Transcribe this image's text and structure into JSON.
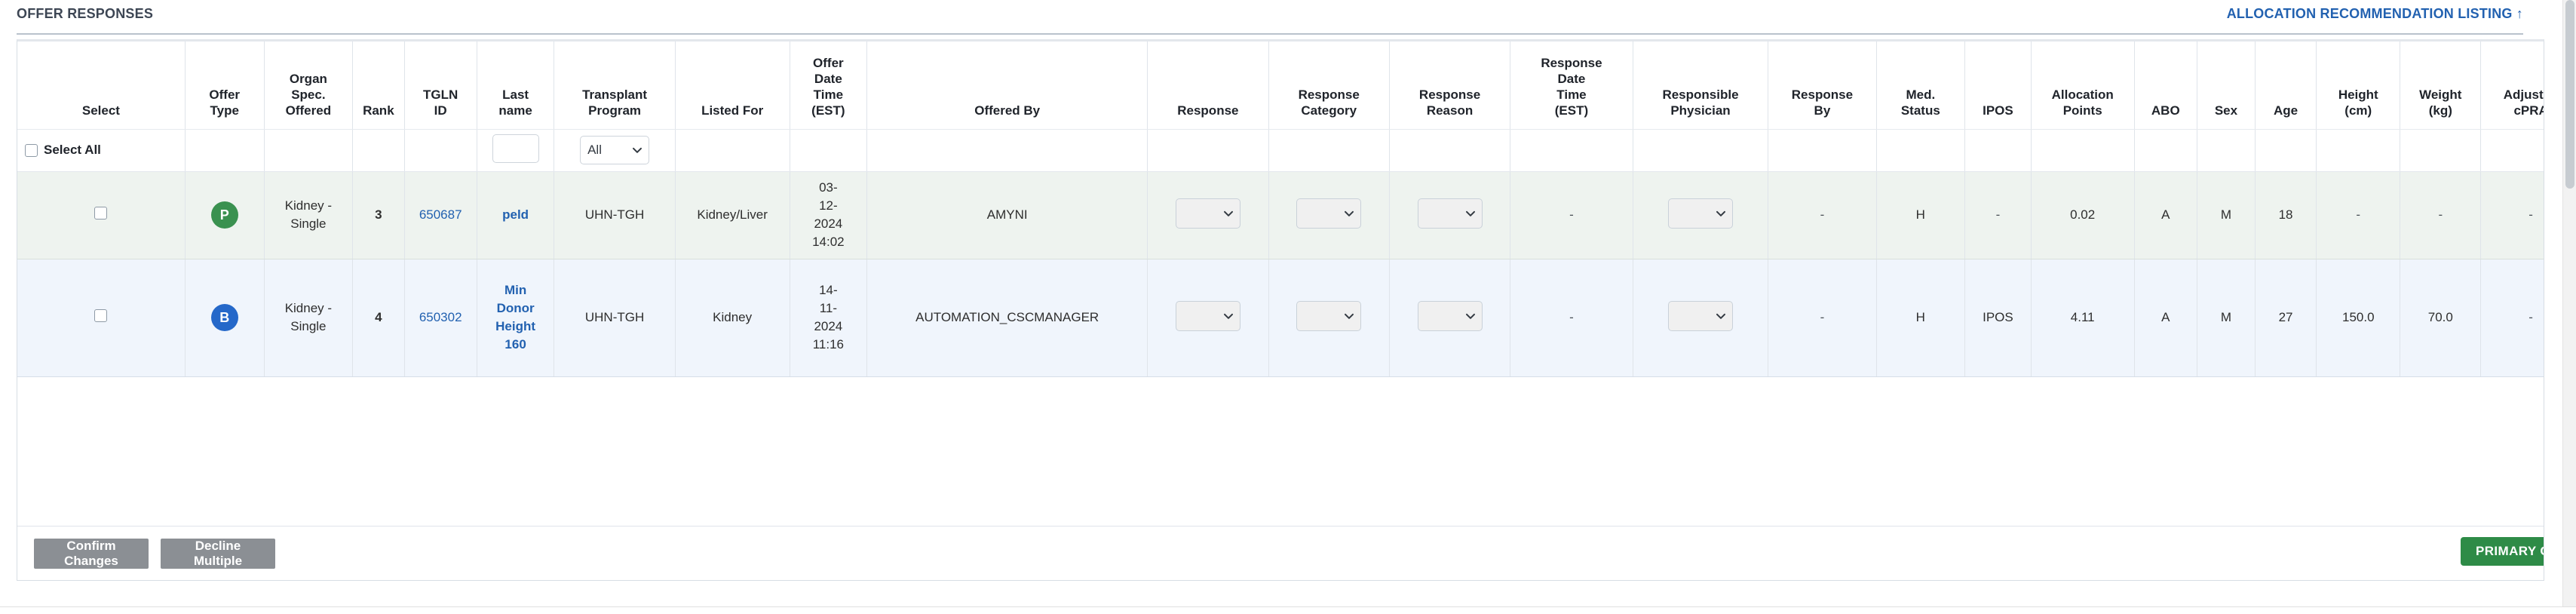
{
  "panel": {
    "title": "OFFER RESPONSES",
    "allocation_link": "ALLOCATION RECOMMENDATION LISTING",
    "allocation_link_arrow": "↑"
  },
  "table": {
    "headers": [
      "Select",
      "Offer Type",
      "Organ Spec. Offered",
      "Rank",
      "TGLN ID",
      "Last name",
      "Transplant Program",
      "Listed For",
      "Offer Date Time (EST)",
      "Offered By",
      "Response",
      "Response Category",
      "Response Reason",
      "Response Date Time (EST)",
      "Responsible Physician",
      "Response By",
      "Med. Status",
      "IPOS",
      "Allocation Points",
      "ABO",
      "Sex",
      "Age",
      "Height (cm)",
      "Weight (kg)",
      "Adjusted cPRA"
    ],
    "header_lines": {
      "select": [
        "Select"
      ],
      "offer_type": [
        "Offer",
        "Type"
      ],
      "organ_spec_offered": [
        "Organ",
        "Spec.",
        "Offered"
      ],
      "rank": [
        "Rank"
      ],
      "tgln_id": [
        "TGLN",
        "ID"
      ],
      "last_name": [
        "Last",
        "name"
      ],
      "transplant_program": [
        "Transplant",
        "Program"
      ],
      "listed_for": [
        "Listed For"
      ],
      "offer_date_time": [
        "Offer",
        "Date",
        "Time",
        "(EST)"
      ],
      "offered_by": [
        "Offered By"
      ],
      "response": [
        "Response"
      ],
      "response_category": [
        "Response",
        "Category"
      ],
      "response_reason": [
        "Response",
        "Reason"
      ],
      "response_date_time": [
        "Response",
        "Date",
        "Time",
        "(EST)"
      ],
      "responsible_physician": [
        "Responsible",
        "Physician"
      ],
      "response_by": [
        "Response",
        "By"
      ],
      "med_status": [
        "Med.",
        "Status"
      ],
      "ipos": [
        "IPOS"
      ],
      "allocation_points": [
        "Allocation",
        "Points"
      ],
      "abo": [
        "ABO"
      ],
      "sex": [
        "Sex"
      ],
      "age": [
        "Age"
      ],
      "height_cm": [
        "Height",
        "(cm)"
      ],
      "weight_kg": [
        "Weight",
        "(kg)"
      ],
      "adjusted_cpra": [
        "Adjusted",
        "cPRA"
      ]
    },
    "filter_row": {
      "select_all_label": "Select All",
      "select_all_checked": false,
      "last_name_filter_value": "",
      "transplant_program_filter_value": "All"
    },
    "rows": [
      {
        "selected": false,
        "offer_type_badge": "P",
        "offer_type_badge_color": "#3a9150",
        "organ_spec_offered": [
          "Kidney -",
          "Single"
        ],
        "rank": "3",
        "tgln_id": "650687",
        "last_name": [
          "peld"
        ],
        "transplant_program": "UHN-TGH",
        "listed_for": "Kidney/Liver",
        "offer_date_time": [
          "03-",
          "12-",
          "2024",
          "14:02"
        ],
        "offered_by": "AMYNI",
        "response": "",
        "response_category": "",
        "response_reason": "",
        "response_date_time": "-",
        "responsible_physician": "",
        "response_by": "-",
        "med_status": "H",
        "ipos": "-",
        "allocation_points": "0.02",
        "abo": "A",
        "sex": "M",
        "age": "18",
        "height_cm": "-",
        "weight_kg": "-",
        "adjusted_cpra": "-"
      },
      {
        "selected": false,
        "offer_type_badge": "B",
        "offer_type_badge_color": "#2568c9",
        "organ_spec_offered": [
          "Kidney -",
          "Single"
        ],
        "rank": "4",
        "tgln_id": "650302",
        "last_name": [
          "Min",
          "Donor",
          "Height",
          "160"
        ],
        "transplant_program": "UHN-TGH",
        "listed_for": "Kidney",
        "offer_date_time": [
          "14-",
          "11-",
          "2024",
          "11:16"
        ],
        "offered_by": "AUTOMATION_CSCMANAGER",
        "response": "",
        "response_category": "",
        "response_reason": "",
        "response_date_time": "-",
        "responsible_physician": "",
        "response_by": "-",
        "med_status": "H",
        "ipos": "IPOS",
        "allocation_points": "4.11",
        "abo": "A",
        "sex": "M",
        "age": "27",
        "height_cm": "150.0",
        "weight_kg": "70.0",
        "adjusted_cpra": "-"
      }
    ]
  },
  "footer": {
    "confirm_changes_label": "Confirm Changes",
    "decline_multiple_label": "Decline Multiple",
    "primary_offer_label": "PRIMARY OFFER"
  },
  "colors": {
    "accent_link": "#2261b0",
    "primary_green": "#2e8b47",
    "badge_green": "#3a9150",
    "badge_blue": "#2568c9",
    "row_a_bg": "#eef3ef",
    "row_b_bg": "#f0f5fc"
  }
}
